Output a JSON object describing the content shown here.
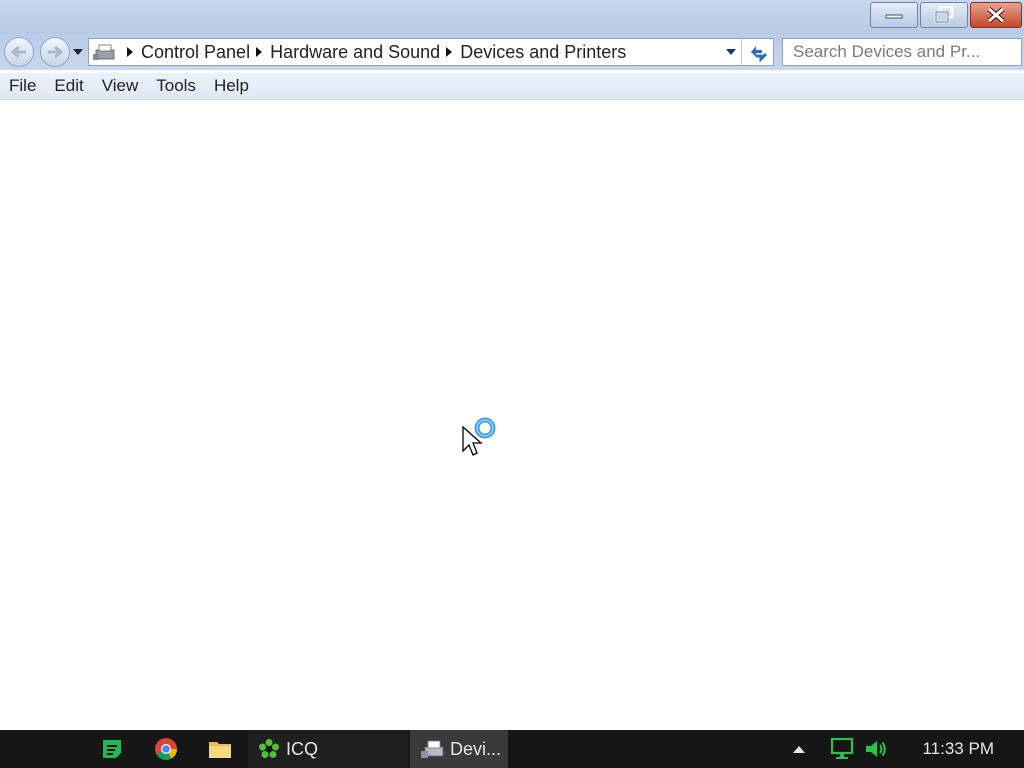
{
  "window": {
    "minimize_icon": "minimize-icon",
    "restore_icon": "restore-icon",
    "close_icon": "close-icon"
  },
  "address_bar": {
    "location_icon": "devices-printers-icon",
    "breadcrumbs": [
      "Control Panel",
      "Hardware and Sound",
      "Devices and Printers"
    ],
    "refresh_icon": "refresh-icon"
  },
  "search": {
    "placeholder": "Search Devices and Pr..."
  },
  "menu": {
    "items": [
      "File",
      "Edit",
      "View",
      "Tools",
      "Help"
    ]
  },
  "cursor": {
    "state": "busy-pointer-icon"
  },
  "taskbar": {
    "pinned": [
      {
        "name": "notes-app-icon",
        "color": "#1db954"
      },
      {
        "name": "chrome-icon",
        "color": "#db4437"
      },
      {
        "name": "folder-icon",
        "color": "#f2cf6b"
      }
    ],
    "tasks": [
      {
        "label": "ICQ",
        "icon": "icq-icon"
      },
      {
        "label": "Devi...",
        "icon": "devices-printers-icon"
      }
    ],
    "tray": {
      "show_hidden_icon": "chevron-up-icon",
      "network_icon": "network-icon",
      "volume_icon": "volume-icon"
    },
    "clock": "11:33 PM"
  },
  "colors": {
    "titlebar": "#b6cbe6",
    "close_button": "#c6452b",
    "taskbar": "#161616",
    "tray_accent": "#2fbf4a"
  }
}
